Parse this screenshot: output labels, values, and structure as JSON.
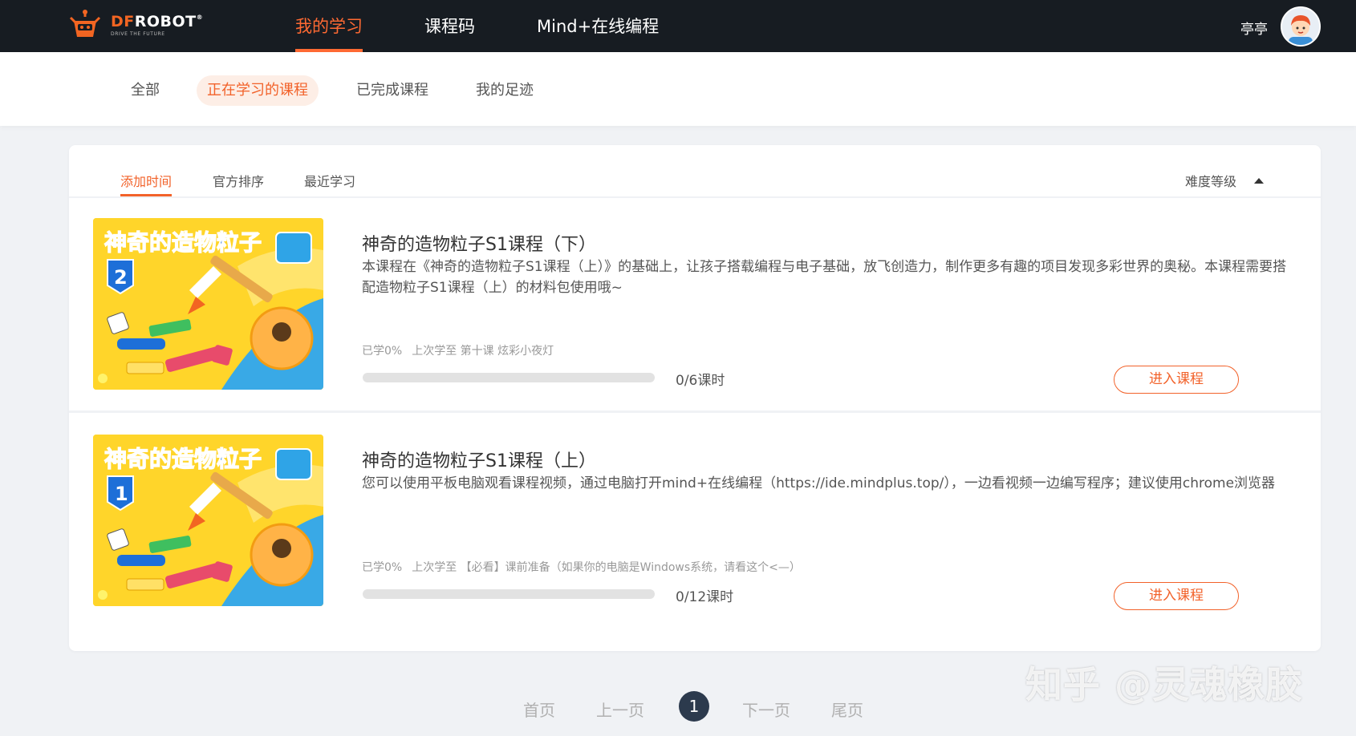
{
  "brand": {
    "name_left": "DF",
    "name_right": "ROBOT",
    "tagline": "DRIVE THE FUTURE"
  },
  "topnav": {
    "items": [
      {
        "label": "我的学习",
        "active": true
      },
      {
        "label": "课程码",
        "active": false
      },
      {
        "label": "Mind+在线编程",
        "active": false
      }
    ],
    "username": "亭亭"
  },
  "subnav": {
    "items": [
      {
        "label": "全部",
        "active": false
      },
      {
        "label": "正在学习的课程",
        "active": true
      },
      {
        "label": "已完成课程",
        "active": false
      },
      {
        "label": "我的足迹",
        "active": false
      }
    ]
  },
  "sort": {
    "items": [
      {
        "label": "添加时间",
        "active": true
      },
      {
        "label": "官方排序",
        "active": false
      },
      {
        "label": "最近学习",
        "active": false
      }
    ],
    "difficulty_label": "难度等级"
  },
  "courses": [
    {
      "thumb_title": "神奇的造物粒子",
      "thumb_number": "2",
      "title": "神奇的造物粒子S1课程（下）",
      "description": "本课程在《神奇的造物粒子S1课程（上）》的基础上，让孩子搭载编程与电子基础，放飞创造力，制作更多有趣的项目发现多彩世界的奥秘。本课程需要搭配造物粒子S1课程（上）的材料包使用哦~",
      "learned": "已学0%",
      "last_learned": "上次学至 第十课 炫彩小夜灯",
      "progress": 0,
      "count": "0/6课时",
      "button": "进入课程"
    },
    {
      "thumb_title": "神奇的造物粒子",
      "thumb_number": "1",
      "title": "神奇的造物粒子S1课程（上）",
      "description": "您可以使用平板电脑观看课程视频，通过电脑打开mind+在线编程（https://ide.mindplus.top/），一边看视频一边编写程序；建议使用chrome浏览器",
      "learned": "已学0%",
      "last_learned": "上次学至 【必看】课前准备（如果你的电脑是Windows系统，请看这个<—）",
      "progress": 0,
      "count": "0/12课时",
      "button": "进入课程"
    }
  ],
  "pagination": {
    "first": "首页",
    "prev": "上一页",
    "current": "1",
    "next": "下一页",
    "last": "尾页"
  },
  "watermark": "知乎 @灵魂橡胶",
  "colors": {
    "accent": "#f2622a",
    "topbar": "#171c22",
    "page_bg": "#f0f2f5",
    "pager_active": "#2c3a4d"
  }
}
